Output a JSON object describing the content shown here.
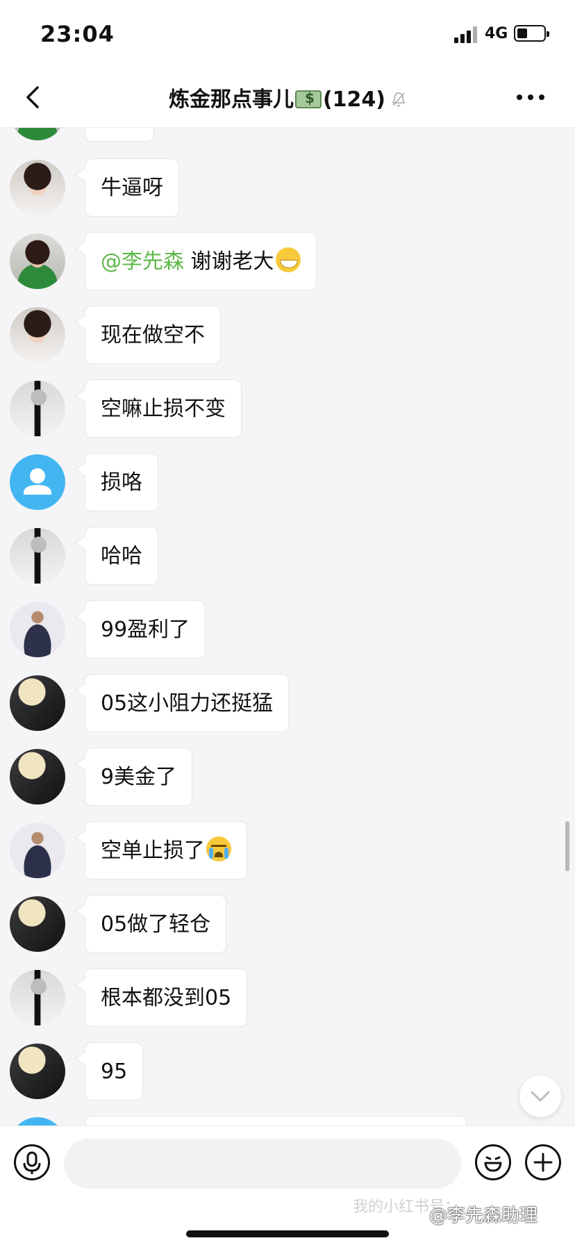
{
  "status_bar": {
    "time": "23:04",
    "network": "4G"
  },
  "nav": {
    "title": "炼金那点事儿",
    "count": "(124)"
  },
  "messages": [
    {
      "avatar": "girl",
      "text": "牛逼呀"
    },
    {
      "avatar": "green",
      "mention": "@李先森",
      "text": " 谢谢老大",
      "emoji": "grin"
    },
    {
      "avatar": "girl",
      "text": "现在做空不"
    },
    {
      "avatar": "man",
      "text": "空嘛止损不变"
    },
    {
      "avatar": "default",
      "text": "损咯"
    },
    {
      "avatar": "man",
      "text": "哈哈"
    },
    {
      "avatar": "suit",
      "text": "99盈利了"
    },
    {
      "avatar": "moon",
      "text": "05这小阻力还挺猛"
    },
    {
      "avatar": "moon",
      "text": "9美金了"
    },
    {
      "avatar": "suit",
      "text": "空单止损了",
      "emoji": "cry"
    },
    {
      "avatar": "moon",
      "text": "05做了轻仓"
    },
    {
      "avatar": "man",
      "text": "根本都没到05"
    },
    {
      "avatar": "moon",
      "text": "95"
    }
  ],
  "input": {
    "placeholder": ""
  },
  "watermark": {
    "text": "@李先森助理",
    "faint_text": "我的小红书号："
  },
  "colors": {
    "mention": "#5db84a",
    "default_avatar": "#43b6f2"
  }
}
